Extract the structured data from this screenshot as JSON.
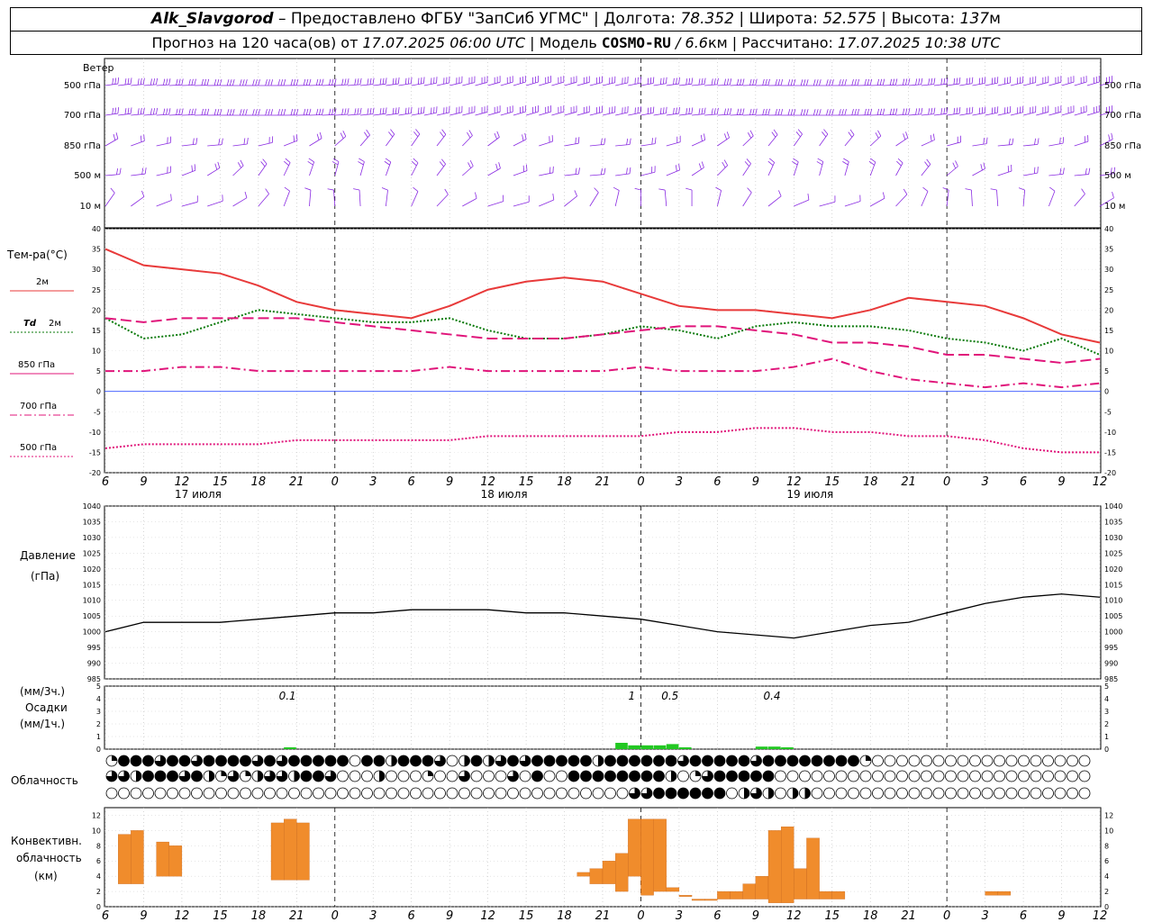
{
  "header": {
    "station": "Alk_Slavgorod",
    "provider": "– Предоставлено ФГБУ \"ЗапСиб УГМС\" |",
    "lon_label": "Долгота:",
    "lon_value": "78.352",
    "lat_label": "| Широта:",
    "lat_value": "52.575",
    "alt_label": "| Высота:",
    "alt_value": "137",
    "alt_unit": "м",
    "forecast_prefix": "Прогноз на 120 часа(ов) от",
    "forecast_time": "17.07.2025 06:00 UTC",
    "model_label": "| Модель",
    "model_name": "COSMO-RU",
    "model_res": "/ 6.6",
    "model_res_unit": "км",
    "computed_label": "| Рассчитано:",
    "computed_time": "17.07.2025 10:38 UTC"
  },
  "wind_panel": {
    "title": "Ветер",
    "levels": [
      "500 гПа",
      "700 гПа",
      "850 гПа",
      "500 м",
      "10 м"
    ],
    "barb_color": "#8a2be2"
  },
  "time_axis": {
    "hour_labels": [
      "6",
      "9",
      "12",
      "15",
      "18",
      "21",
      "0",
      "3",
      "6",
      "9",
      "12",
      "15",
      "18",
      "21",
      "0",
      "3",
      "6",
      "9",
      "12",
      "15",
      "18",
      "21",
      "0",
      "3",
      "6",
      "9",
      "12"
    ],
    "day_labels": [
      "17 июля",
      "18 июля",
      "19 июля"
    ]
  },
  "chart_data": [
    {
      "type": "line",
      "title": "Тем-ра(°C)",
      "x_hours_from_start": [
        0,
        3,
        6,
        9,
        12,
        15,
        18,
        21,
        24,
        27,
        30,
        33,
        36,
        39,
        42,
        45,
        48,
        51,
        54,
        57,
        60,
        63,
        66,
        69,
        72,
        75,
        78
      ],
      "ylim": [
        -20,
        40
      ],
      "yticks": [
        -20,
        -15,
        -10,
        -5,
        0,
        5,
        10,
        15,
        20,
        25,
        30,
        35,
        40
      ],
      "series": [
        {
          "name": "2м",
          "color": "#e83a3a",
          "style": "solid",
          "values": [
            35,
            31,
            30,
            29,
            26,
            22,
            20,
            19,
            18,
            21,
            25,
            27,
            28,
            27,
            24,
            21,
            20,
            20,
            19,
            18,
            20,
            23,
            22,
            21,
            18,
            14,
            12
          ]
        },
        {
          "name": "Td 2м",
          "color": "#0a7a0a",
          "style": "dotted",
          "values": [
            18,
            13,
            14,
            17,
            20,
            19,
            18,
            17,
            17,
            18,
            15,
            13,
            13,
            14,
            16,
            15,
            13,
            16,
            17,
            16,
            16,
            15,
            13,
            12,
            10,
            13,
            9
          ]
        },
        {
          "name": "850 гПа",
          "color": "#e0147a",
          "style": "dashed",
          "values": [
            18,
            17,
            18,
            18,
            18,
            18,
            17,
            16,
            15,
            14,
            13,
            13,
            13,
            14,
            15,
            16,
            16,
            15,
            14,
            12,
            12,
            11,
            9,
            9,
            8,
            7,
            8
          ]
        },
        {
          "name": "700 гПа",
          "color": "#e0147a",
          "style": "dashdot",
          "values": [
            5,
            5,
            6,
            6,
            5,
            5,
            5,
            5,
            5,
            6,
            5,
            5,
            5,
            5,
            6,
            5,
            5,
            5,
            6,
            8,
            5,
            3,
            2,
            1,
            2,
            1,
            2
          ]
        },
        {
          "name": "500 гПа",
          "color": "#e0147a",
          "style": "dotted",
          "values": [
            -14,
            -13,
            -13,
            -13,
            -13,
            -12,
            -12,
            -12,
            -12,
            -12,
            -11,
            -11,
            -11,
            -11,
            -11,
            -10,
            -10,
            -9,
            -9,
            -10,
            -10,
            -11,
            -11,
            -12,
            -14,
            -15,
            -15
          ]
        }
      ]
    },
    {
      "type": "line",
      "title": "Давление",
      "ylabel": "(гПа)",
      "x_hours_from_start": [
        0,
        3,
        6,
        9,
        12,
        15,
        18,
        21,
        24,
        27,
        30,
        33,
        36,
        39,
        42,
        45,
        48,
        51,
        54,
        57,
        60,
        63,
        66,
        69,
        72,
        75,
        78
      ],
      "ylim": [
        985,
        1040
      ],
      "yticks": [
        985,
        990,
        995,
        1000,
        1005,
        1010,
        1015,
        1020,
        1025,
        1030,
        1035,
        1040
      ],
      "series": [
        {
          "name": "",
          "color": "#000000",
          "style": "solid",
          "values": [
            1000,
            1003,
            1003,
            1003,
            1004,
            1005,
            1006,
            1006,
            1007,
            1007,
            1007,
            1006,
            1006,
            1005,
            1004,
            1002,
            1000,
            999,
            998,
            1000,
            1002,
            1003,
            1006,
            1009,
            1011,
            1012,
            1011
          ]
        }
      ]
    },
    {
      "type": "bar",
      "title": "Осадки",
      "ylabel": "(мм/3ч.)",
      "ylabel2": "(мм/1ч.)",
      "ylim": [
        0,
        5
      ],
      "yticks": [
        0,
        1,
        2,
        3,
        4,
        5
      ],
      "x_hours_from_start": [
        14,
        40,
        41,
        42,
        43,
        44,
        45,
        51,
        52,
        53
      ],
      "values": [
        0.1,
        0.5,
        0.3,
        0.3,
        0.3,
        0.4,
        0.1,
        0.2,
        0.2,
        0.1
      ],
      "color": "#22c822",
      "annotations": [
        {
          "x": 14,
          "text": "0.1"
        },
        {
          "x": 41,
          "text": "1"
        },
        {
          "x": 44,
          "text": "0.5"
        },
        {
          "x": 52,
          "text": "0.4"
        }
      ]
    },
    {
      "type": "table",
      "title": "Облачность",
      "rows": 3,
      "note": "cloud cover in eighths per hour, three layers",
      "layers": [
        [
          2,
          8,
          8,
          8,
          6,
          8,
          8,
          6,
          8,
          8,
          8,
          8,
          6,
          8,
          6,
          8,
          8,
          8,
          8,
          8,
          0,
          8,
          8,
          4,
          8,
          8,
          8,
          6,
          0,
          4,
          8,
          4,
          6,
          8,
          6,
          8,
          8,
          8,
          8,
          8,
          4,
          8,
          8,
          8,
          8,
          8,
          8,
          6,
          8,
          8,
          8,
          8,
          8,
          6,
          8,
          8,
          8,
          8,
          8,
          8,
          8,
          8,
          2,
          0,
          0,
          0,
          0,
          0,
          0,
          0,
          0,
          0,
          0,
          0,
          0,
          0,
          0,
          0,
          0,
          0,
          0
        ],
        [
          6,
          6,
          4,
          8,
          8,
          8,
          6,
          8,
          4,
          2,
          6,
          2,
          4,
          6,
          6,
          4,
          8,
          8,
          6,
          0,
          0,
          0,
          4,
          0,
          0,
          0,
          2,
          0,
          0,
          6,
          0,
          0,
          0,
          6,
          0,
          8,
          0,
          0,
          8,
          8,
          8,
          8,
          8,
          8,
          8,
          8,
          4,
          0,
          2,
          6,
          8,
          8,
          8,
          8,
          8,
          0,
          0,
          0,
          0,
          0,
          0,
          0,
          0,
          0,
          0,
          0,
          0,
          0,
          0,
          0,
          0,
          0,
          0,
          0,
          0,
          0,
          0,
          0,
          0,
          0,
          0
        ],
        [
          0,
          0,
          0,
          0,
          0,
          0,
          0,
          0,
          0,
          0,
          0,
          0,
          0,
          0,
          0,
          0,
          0,
          0,
          0,
          0,
          0,
          0,
          0,
          0,
          0,
          0,
          0,
          0,
          0,
          0,
          0,
          0,
          0,
          0,
          0,
          0,
          0,
          0,
          0,
          0,
          0,
          0,
          0,
          6,
          6,
          8,
          8,
          8,
          8,
          8,
          8,
          0,
          4,
          6,
          4,
          0,
          4,
          4,
          0,
          0,
          0,
          0,
          0,
          0,
          0,
          0,
          0,
          0,
          0,
          0,
          0,
          0,
          0,
          0,
          0,
          0,
          0,
          0,
          0,
          0,
          0
        ]
      ]
    },
    {
      "type": "bar",
      "title": "Конвективн. облачность",
      "ylabel": "(км)",
      "ylim": [
        0,
        13
      ],
      "yticks": [
        0,
        2,
        4,
        6,
        8,
        10,
        12
      ],
      "color": "#f08c2c",
      "x_hours_from_start": [
        1,
        2,
        4,
        5,
        13,
        14,
        15,
        37,
        38,
        39,
        40,
        41,
        42,
        43,
        44,
        45,
        46,
        47,
        48,
        49,
        50,
        51,
        52,
        53,
        54,
        55,
        56,
        57,
        69,
        70
      ],
      "bases": [
        3,
        3,
        4,
        4,
        3.5,
        3.5,
        3.5,
        4,
        3,
        3,
        2,
        4,
        1.5,
        2,
        2,
        2,
        2,
        1.5,
        1,
        1,
        1,
        1,
        0.5,
        0.5,
        1,
        1,
        1,
        1,
        1.5,
        1.5
      ],
      "tops": [
        9.5,
        10,
        8.5,
        8,
        11,
        11.5,
        11,
        4.5,
        5,
        6,
        7,
        11.5,
        11.5,
        11.5,
        2.5,
        1.5,
        1,
        1,
        2,
        2,
        3,
        4,
        10,
        10.5,
        5,
        9,
        2,
        2,
        2,
        2
      ]
    }
  ],
  "ylabels": {
    "temp_title": "Тем-ра(°C)",
    "legend_2m": "2м",
    "legend_td_a": "Td",
    "legend_td_b": "2м",
    "legend_850": "850 гПа",
    "legend_700": "700 гПа",
    "legend_500": "500 гПа",
    "pressure_a": "Давление",
    "pressure_b": "(гПа)",
    "precip_a": "(мм/3ч.)",
    "precip_b": "Осадки",
    "precip_c": "(мм/1ч.)",
    "cloud": "Облачность",
    "conv_a": "Конвективн.",
    "conv_b": "облачность",
    "conv_c": "(км)"
  }
}
